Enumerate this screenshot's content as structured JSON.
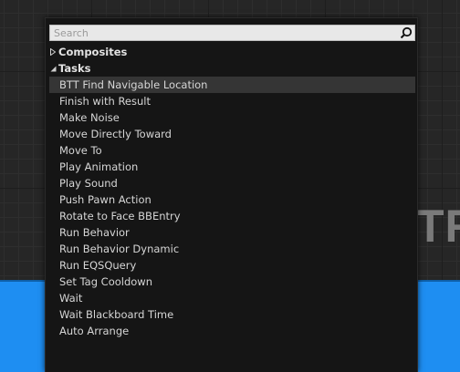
{
  "background": {
    "node_text": "TR",
    "node_color": "#1e8ef2"
  },
  "search": {
    "placeholder": "Search",
    "value": ""
  },
  "categories": [
    {
      "label": "Composites",
      "expanded": false
    },
    {
      "label": "Tasks",
      "expanded": true,
      "items": [
        {
          "label": "BTT Find Navigable Location",
          "selected": true
        },
        {
          "label": "Finish with Result"
        },
        {
          "label": "Make Noise"
        },
        {
          "label": "Move Directly Toward"
        },
        {
          "label": "Move To"
        },
        {
          "label": "Play Animation"
        },
        {
          "label": "Play Sound"
        },
        {
          "label": "Push Pawn Action"
        },
        {
          "label": "Rotate to Face BBEntry"
        },
        {
          "label": "Run Behavior"
        },
        {
          "label": "Run Behavior Dynamic"
        },
        {
          "label": "Run EQSQuery"
        },
        {
          "label": "Set Tag Cooldown"
        },
        {
          "label": "Wait"
        },
        {
          "label": "Wait Blackboard Time"
        }
      ]
    }
  ],
  "extra_item": {
    "label": "Auto Arrange"
  },
  "icons": {
    "search": "search-icon",
    "collapsed": "triangle-right-icon",
    "expanded": "triangle-down-icon"
  }
}
